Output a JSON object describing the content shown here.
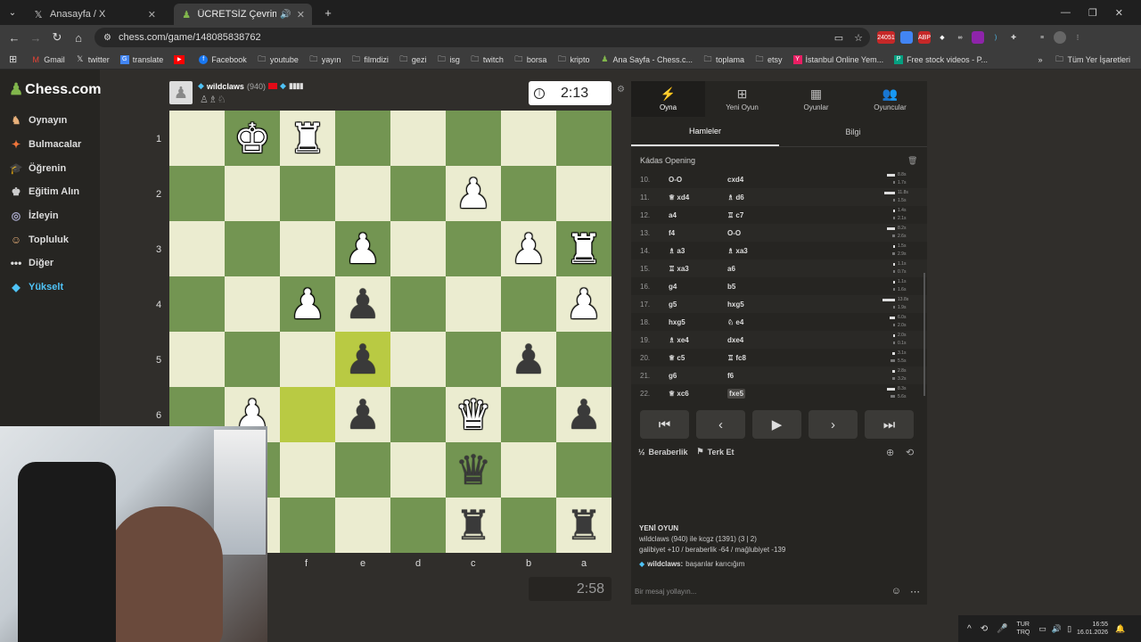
{
  "browser": {
    "tabs": [
      {
        "icon": "x-icon",
        "title": "Anasayfa / X",
        "active": false
      },
      {
        "icon": "chess-icon",
        "title": "ÜCRETSİZ Çevrimiçi Satranç",
        "active": true
      }
    ],
    "new_tab": "+",
    "url": "chess.com/game/148085838762",
    "ext_badge": "24051",
    "bookmarks": [
      "Gmail",
      "twitter",
      "translate",
      "",
      "Facebook",
      "youtube",
      "yayın",
      "filmdizi",
      "gezi",
      "isg",
      "twitch",
      "borsa",
      "kripto",
      "Ana Sayfa - Chess.c...",
      "toplama",
      "etsy",
      "İstanbul Online Yem...",
      "Free stock videos - P..."
    ],
    "bookmarks_all": "Tüm Yer İşaretleri"
  },
  "sidebar": {
    "brand": "Chess.com",
    "items": [
      "Oynayın",
      "Bulmacalar",
      "Öğrenin",
      "Eğitim Alın",
      "İzleyin",
      "Topluluk",
      "Diğer",
      "Yükselt"
    ]
  },
  "game": {
    "top_player": {
      "name": "wildclaws",
      "rating": "(940)",
      "clock": "2:13"
    },
    "bottom_clock": "2:58",
    "ranks": [
      "1",
      "2",
      "3",
      "4",
      "5",
      "6"
    ],
    "files": [
      "f",
      "e",
      "d",
      "c",
      "b",
      "a"
    ],
    "board": [
      [
        "",
        "wK",
        "wR",
        "",
        "",
        "",
        "",
        ""
      ],
      [
        "",
        "",
        "",
        "",
        "",
        "wP",
        "",
        ""
      ],
      [
        "",
        "",
        "",
        "wP",
        "",
        "",
        "wP",
        "wR"
      ],
      [
        "",
        "",
        "wP",
        "bP",
        "",
        "",
        "",
        "wP"
      ],
      [
        "",
        "",
        "",
        "bP",
        "",
        "",
        "bP",
        ""
      ],
      [
        "",
        "wP",
        "",
        "bP",
        "",
        "wQ",
        "",
        "bP"
      ],
      [
        "",
        "",
        "",
        "",
        "",
        "bQ",
        "",
        ""
      ],
      [
        "",
        "",
        "",
        "",
        "",
        "bR",
        "",
        "bR"
      ]
    ]
  },
  "panel": {
    "tabs": [
      {
        "icon": "bolt-icon",
        "label": "Oyna"
      },
      {
        "icon": "plus-icon",
        "label": "Yeni Oyun"
      },
      {
        "icon": "board-icon",
        "label": "Oyunlar"
      },
      {
        "icon": "players-icon",
        "label": "Oyuncular"
      }
    ],
    "subtabs": [
      "Hamleler",
      "Bilgi"
    ],
    "opening": "Kádas Opening",
    "moves": [
      {
        "n": "10.",
        "w": "O-O",
        "b": "cxd4",
        "wi": "",
        "bi": "",
        "tw": 0.3,
        "tb": 0.05,
        "t1": "8.8s",
        "t2": "1.7s"
      },
      {
        "n": "11.",
        "w": "xd4",
        "b": "d6",
        "wi": "♕",
        "bi": "♗",
        "tw": 0.4,
        "tb": 0.05,
        "t1": "11.8s",
        "t2": "1.5s"
      },
      {
        "n": "12.",
        "w": "a4",
        "b": "c7",
        "wi": "",
        "bi": "♖",
        "tw": 0.05,
        "tb": 0.05,
        "t1": "1.4s",
        "t2": "2.1s"
      },
      {
        "n": "13.",
        "w": "f4",
        "b": "O-O",
        "wi": "",
        "bi": "",
        "tw": 0.3,
        "tb": 0.1,
        "t1": "8.2s",
        "t2": "2.6s"
      },
      {
        "n": "14.",
        "w": "a3",
        "b": "xa3",
        "wi": "♗",
        "bi": "♗",
        "tw": 0.05,
        "tb": 0.1,
        "t1": "1.5s",
        "t2": "2.9s"
      },
      {
        "n": "15.",
        "w": "xa3",
        "b": "a6",
        "wi": "♖",
        "bi": "",
        "tw": 0.05,
        "tb": 0.05,
        "t1": "1.1s",
        "t2": "0.7s"
      },
      {
        "n": "16.",
        "w": "g4",
        "b": "b5",
        "wi": "",
        "bi": "",
        "tw": 0.05,
        "tb": 0.05,
        "t1": "1.1s",
        "t2": "1.6s"
      },
      {
        "n": "17.",
        "w": "g5",
        "b": "hxg5",
        "wi": "",
        "bi": "",
        "tw": 0.45,
        "tb": 0.08,
        "t1": "13.8s",
        "t2": "1.9s"
      },
      {
        "n": "18.",
        "w": "hxg5",
        "b": "e4",
        "wi": "",
        "bi": "♘",
        "tw": 0.2,
        "tb": 0.08,
        "t1": "6.0s",
        "t2": "2.0s"
      },
      {
        "n": "19.",
        "w": "xe4",
        "b": "dxe4",
        "wi": "♗",
        "bi": "",
        "tw": 0.08,
        "tb": 0.05,
        "t1": "2.0s",
        "t2": "0.1s"
      },
      {
        "n": "20.",
        "w": "c5",
        "b": "fc8",
        "wi": "♕",
        "bi": "♖",
        "tw": 0.1,
        "tb": 0.15,
        "t1": "3.1s",
        "t2": "5.5s"
      },
      {
        "n": "21.",
        "w": "g6",
        "b": "f6",
        "wi": "",
        "bi": "",
        "tw": 0.1,
        "tb": 0.1,
        "t1": "2.8s",
        "t2": "3.2s"
      },
      {
        "n": "22.",
        "w": "xc6",
        "b": "fxe5",
        "wi": "♕",
        "bi": "",
        "tw": 0.3,
        "tb": 0.15,
        "t1": "8.3s",
        "t2": "5.6s"
      }
    ],
    "actions": {
      "draw": "Beraberlik",
      "resign": "Terk Et"
    },
    "chat": {
      "title": "YENİ OYUN",
      "line1": "wildclaws (940) ile kcgz (1391) (3 | 2)",
      "line2": "galibiyet +10 / beraberlik -64 / mağlubiyet -139",
      "user": "wildclaws:",
      "message": "başarılar karıcığım",
      "placeholder": "Bir mesaj yollayın..."
    }
  },
  "taskbar": {
    "lang1": "TUR",
    "lang2": "TRQ",
    "time": "16:55",
    "date": "16.01.2026"
  }
}
